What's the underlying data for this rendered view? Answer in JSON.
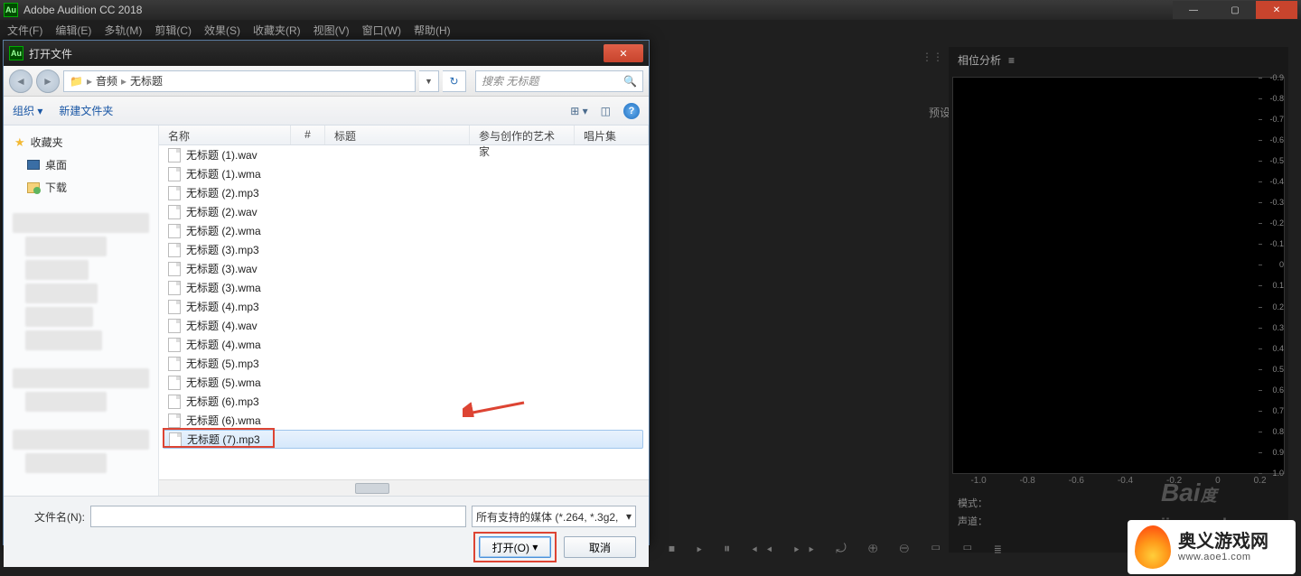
{
  "app": {
    "title": "Adobe Audition CC 2018",
    "icon_text": "Au"
  },
  "menu": {
    "file": "文件(F)",
    "edit": "编辑(E)",
    "multitrack": "多轨(M)",
    "clip": "剪辑(C)",
    "effect": "效果(S)",
    "favorites": "收藏夹(R)",
    "view": "视图(V)",
    "window": "窗口(W)",
    "help": "帮助(H)"
  },
  "right_panel": {
    "title": "相位分析",
    "preset_left": "预设",
    "scale": [
      "-0.9",
      "-0.8",
      "-0.7",
      "-0.6",
      "-0.5",
      "-0.4",
      "-0.3",
      "-0.2",
      "-0.1",
      "0",
      "0.1",
      "0.2",
      "0.3",
      "0.4",
      "0.5",
      "0.6",
      "0.7",
      "0.8",
      "0.9",
      "1.0"
    ],
    "xaxis": [
      "-1.0",
      "-0.8",
      "-0.6",
      "-0.4",
      "-0.2",
      "0",
      "0.2"
    ],
    "mode_label": "模式：",
    "channel_label": "声道："
  },
  "dialog": {
    "title": "打开文件",
    "breadcrumb": {
      "seg1": "音频",
      "seg2": "无标题"
    },
    "search_placeholder": "搜索 无标题",
    "toolbar": {
      "organize": "组织 ▾",
      "new_folder": "新建文件夹"
    },
    "columns": {
      "name": "名称",
      "num": "#",
      "title": "标题",
      "artist": "参与创作的艺术家",
      "album": "唱片集"
    },
    "files": [
      "无标题 (1).wav",
      "无标题 (1).wma",
      "无标题 (2).mp3",
      "无标题 (2).wav",
      "无标题 (2).wma",
      "无标题 (3).mp3",
      "无标题 (3).wav",
      "无标题 (3).wma",
      "无标题 (4).mp3",
      "无标题 (4).wav",
      "无标题 (4).wma",
      "无标题 (5).mp3",
      "无标题 (5).wma",
      "无标题 (6).mp3",
      "无标题 (6).wma",
      "无标题 (7).mp3"
    ],
    "selected_index": 15,
    "sidebar": {
      "favorites": "收藏夹",
      "desktop": "桌面",
      "downloads": "下载"
    },
    "filename_label": "文件名(N):",
    "filetype": "所有支持的媒体 (*.264, *.3g2,",
    "open": "打开(O)",
    "cancel": "取消"
  },
  "watermark": {
    "baidu": "Bai",
    "jing": "jingyan.ba"
  },
  "logo": {
    "cn": "奥义游戏网",
    "url": "www.aoe1.com"
  }
}
